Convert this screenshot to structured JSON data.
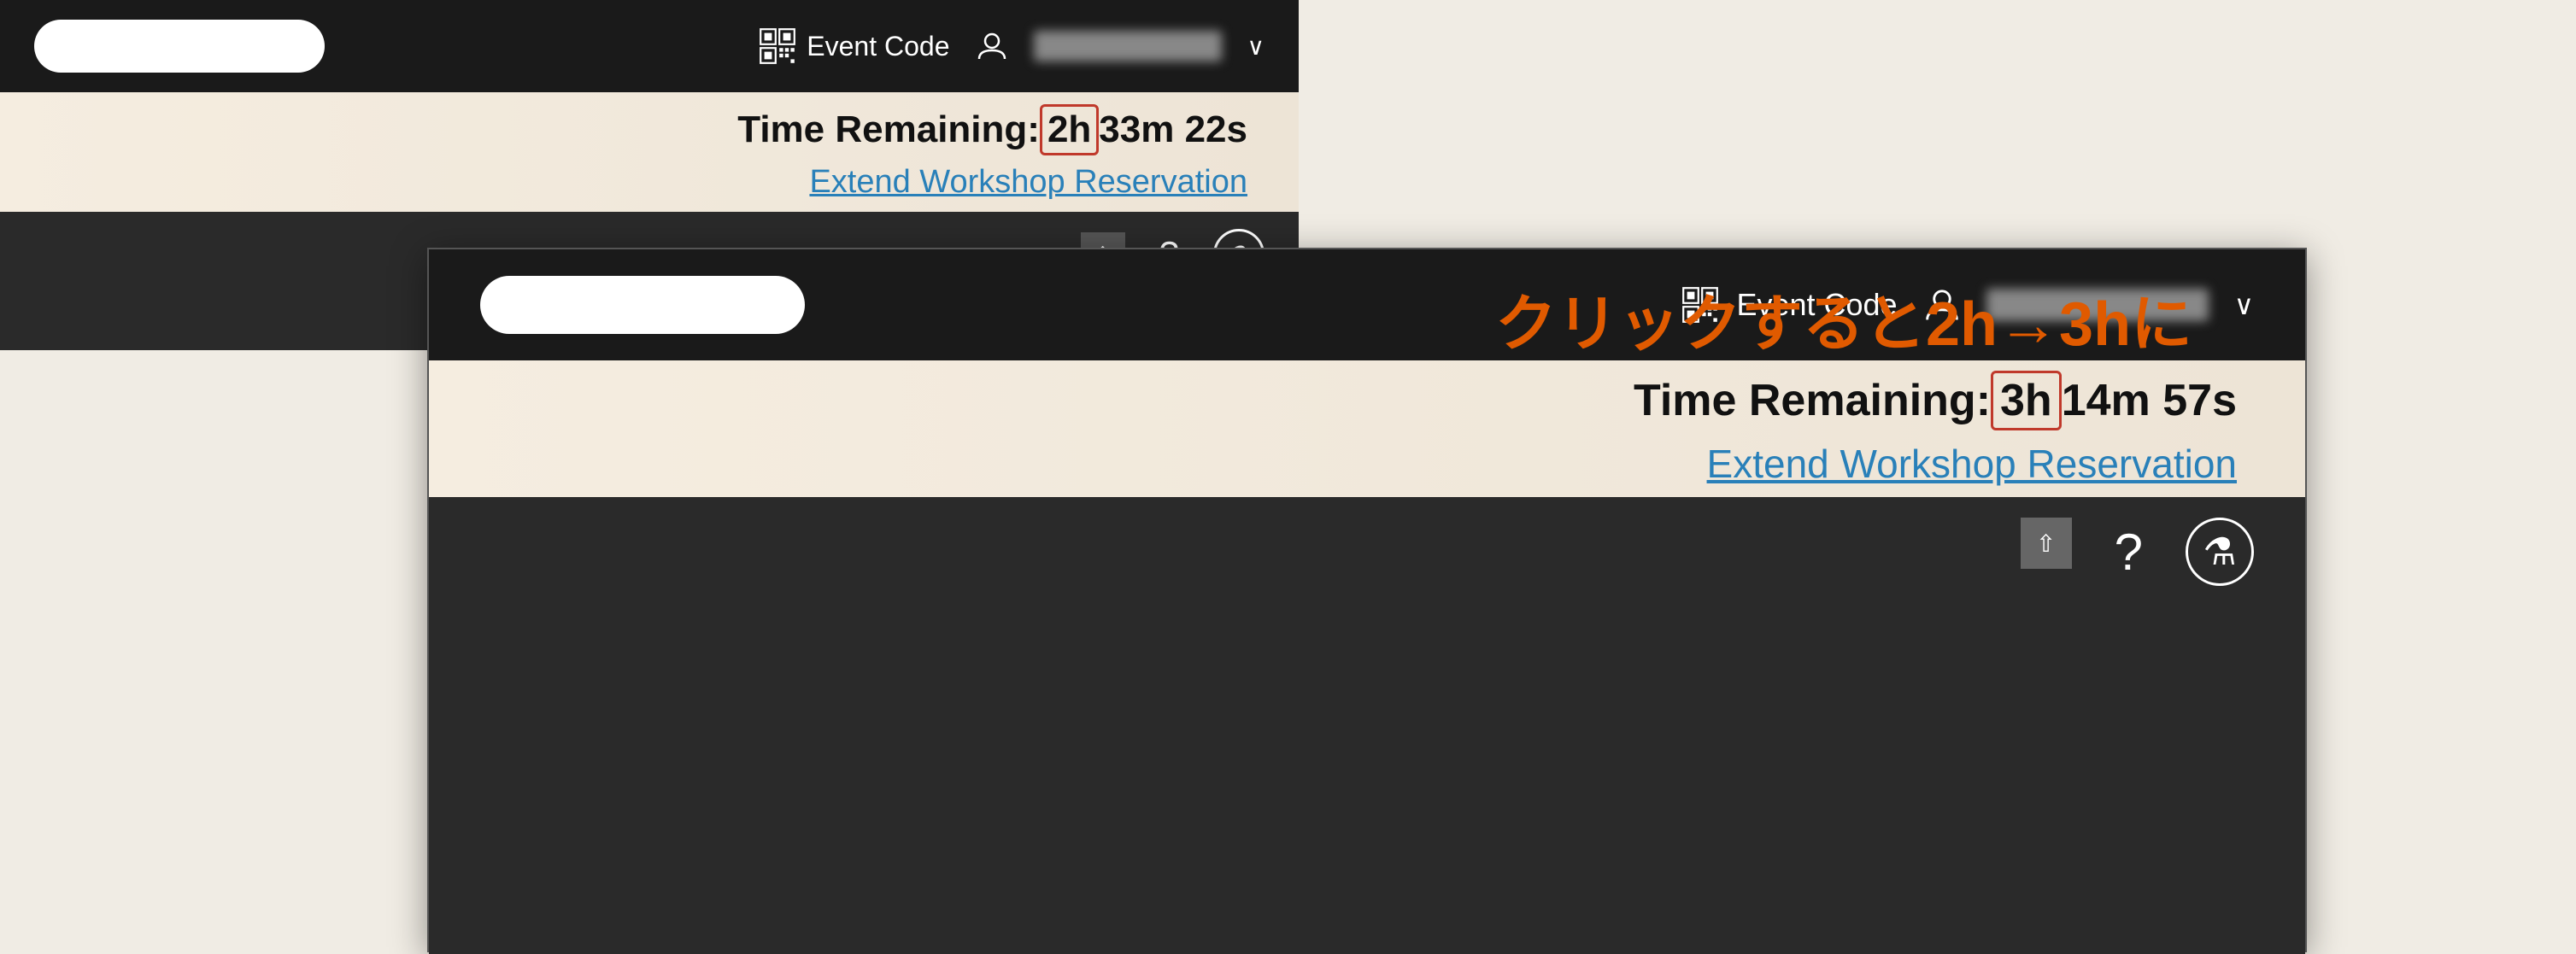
{
  "top": {
    "navbar": {
      "event_code_label": "Event Code",
      "chevron": "∨"
    },
    "time_bar": {
      "label": "Time Remaining:",
      "hours": "2h",
      "minutes_seconds": " 33m 22s",
      "extend_link": "Extend Workshop Reservation"
    },
    "bottom_bar": {
      "icons": [
        "?",
        "🧪"
      ]
    }
  },
  "bottom": {
    "navbar": {
      "event_code_label": "Event Code",
      "chevron": "∨"
    },
    "time_bar": {
      "label": "Time Remaining:",
      "hours": "3h",
      "minutes_seconds": " 14m 57s",
      "extend_link": "Extend Workshop Reservation"
    },
    "bottom_bar": {
      "icons": [
        "?",
        "🧪"
      ]
    }
  },
  "annotation": {
    "text": "クリックすると2h→3hに"
  }
}
